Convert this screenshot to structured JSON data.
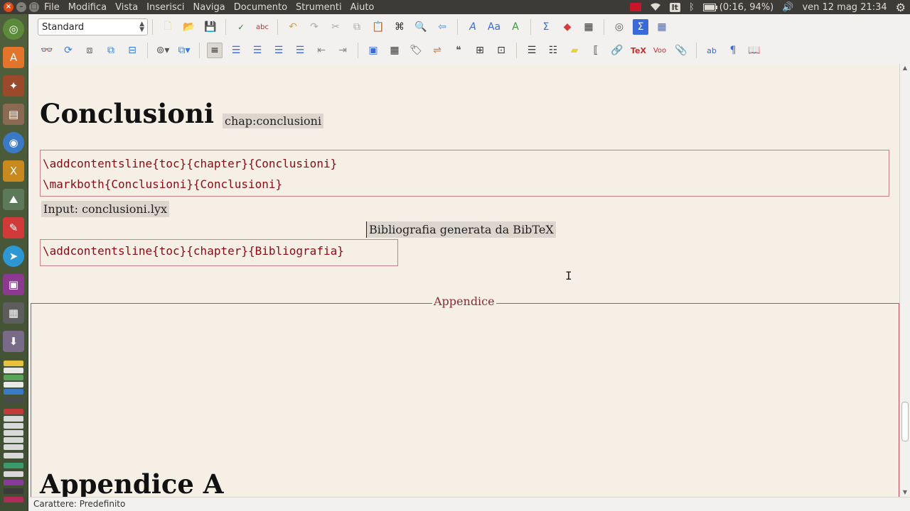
{
  "top_panel": {
    "menu": [
      "File",
      "Modifica",
      "Vista",
      "Inserisci",
      "Naviga",
      "Documento",
      "Strumenti",
      "Aiuto"
    ],
    "keyboard_layout": "It",
    "battery": "(0:16, 94%)",
    "clock": "ven 12 mag 21:34"
  },
  "toolbar": {
    "style_select_value": "Standard"
  },
  "document": {
    "chapter_title": "Conclusioni",
    "chapter_label": "chap:conclusioni",
    "ert1_lines": [
      "\\addcontentsline{toc}{chapter}{Conclusioni}",
      "\\markboth{Conclusioni}{Conclusioni}"
    ],
    "input_inset": "Input: conclusioni.lyx",
    "bibliography_inset": "Bibliografia generata da BibTeX",
    "ert2_line": "\\addcontentsline{toc}{chapter}{Bibliografia}",
    "appendix_label": "Appendice",
    "appendix_title": "Appendice A"
  },
  "statusbar": {
    "text": "Carattere: Predefinito"
  },
  "colors": {
    "ert_text": "#8b0a14",
    "ert_border": "#c97f85",
    "document_bg": "#f5efe6",
    "launcher_bg": "#4b5a3a",
    "panel_bg": "#3c3b37"
  }
}
